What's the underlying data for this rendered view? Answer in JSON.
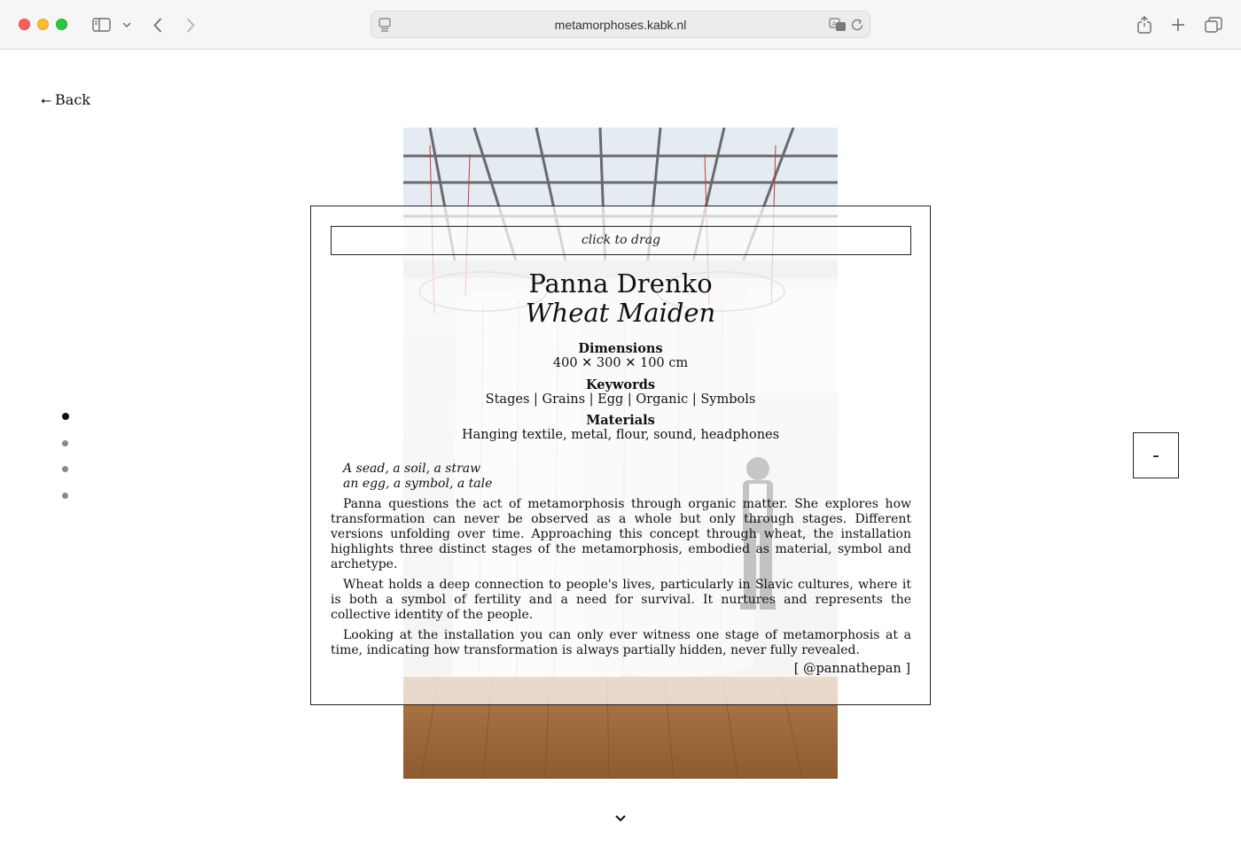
{
  "browser": {
    "url": "metamorphoses.kabk.nl"
  },
  "nav": {
    "back_label": "Back",
    "back_arrow": "⭠"
  },
  "slideshow": {
    "dots": [
      {
        "active": true
      },
      {
        "active": false
      },
      {
        "active": false
      },
      {
        "active": false
      }
    ],
    "toggle_label": "-"
  },
  "panel": {
    "drag_label": "click to drag",
    "artist": "Panna Drenko",
    "title": "Wheat Maiden",
    "dimensions_heading": "Dimensions",
    "dimensions_value": "400 ✕ 300 ✕ 100 cm",
    "keywords_heading": "Keywords",
    "keywords_value": "Stages | Grains | Egg | Organic | Symbols",
    "materials_heading": "Materials",
    "materials_value": "Hanging textile, metal, flour, sound, headphones",
    "poem_line1": "A sead, a soil, a straw",
    "poem_line2": "an egg, a symbol, a tale",
    "paragraphs": [
      "Panna questions the act of metamorphosis through organic matter. She explores how transformation can never be observed as a whole but only through stages. Different versions unfolding over time. Approaching this concept through wheat, the installation highlights three distinct stages of the metamorphosis, embodied as material, symbol and archetype.",
      "Wheat holds a deep connection to people's lives, particularly in Slavic cultures, where it is both a symbol of fertility and a need for survival. It nurtures and represents the collective identity of the people.",
      "Looking at the installation you can only ever witness one stage of metamorphosis at a time, indicating how transformation is always partially hidden, never fully revealed."
    ],
    "handle": "[ @pannathepan ]"
  }
}
